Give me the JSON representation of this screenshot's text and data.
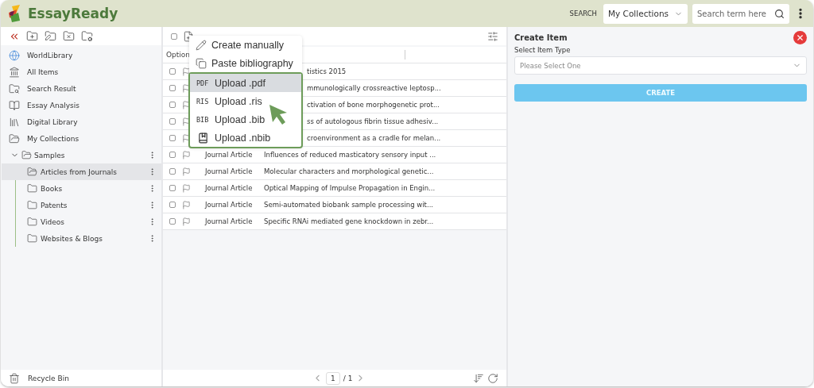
{
  "header": {
    "logo": "EssayReady",
    "search_label": "SEARCH",
    "scope": "My Collections",
    "search": {
      "placeholder": "Search term here"
    }
  },
  "sidebar": {
    "items": [
      {
        "label": "WorldLibrary",
        "selected": false
      },
      {
        "label": "All Items",
        "selected": false
      },
      {
        "label": "Search Result",
        "selected": false
      },
      {
        "label": "Essay Analysis",
        "selected": false
      },
      {
        "label": "Digital Library",
        "selected": false
      },
      {
        "label": "My Collections",
        "selected": false
      }
    ],
    "tree": {
      "label": "Samples",
      "expanded": true,
      "children": [
        {
          "label": "Articles from Journals",
          "selected": true
        },
        {
          "label": "Books",
          "selected": false
        },
        {
          "label": "Patents",
          "selected": false
        },
        {
          "label": "Videos",
          "selected": false
        },
        {
          "label": "Websites & Blogs",
          "selected": false
        }
      ]
    },
    "footer": "Recycle Bin"
  },
  "table": {
    "select_all": {
      "checked": false
    },
    "columns": [
      "Option"
    ],
    "rows": [
      {
        "checked": false,
        "title": "tistics 2015"
      },
      {
        "checked": false,
        "title": "mmunologically crossreactive leptosp..."
      },
      {
        "checked": false,
        "title": "ctivation of bone morphogenetic prot..."
      },
      {
        "checked": false,
        "title": "ss of autologous fibrin tissue adhesiv..."
      },
      {
        "checked": false,
        "title": "croenvironment as a cradle for melan..."
      },
      {
        "checked": false,
        "type": "Journal Article",
        "title": "Influences of reduced masticatory sensory input ..."
      },
      {
        "checked": false,
        "type": "Journal Article",
        "title": "Molecular characters and morphological genetic..."
      },
      {
        "checked": false,
        "type": "Journal Article",
        "title": "Optical Mapping of Impulse Propagation in Engin..."
      },
      {
        "checked": false,
        "type": "Journal Article",
        "title": "Semi-automated biobank sample processing wit..."
      },
      {
        "checked": false,
        "type": "Journal Article",
        "title": "Specific RNAi mediated gene knockdown in zebr..."
      }
    ]
  },
  "menu": {
    "items": [
      {
        "kind": "create",
        "label": "Create manually",
        "selected": false
      },
      {
        "kind": "paste",
        "label": "Paste bibliography",
        "selected": false
      }
    ],
    "upload_items": [
      {
        "kind": "tag",
        "tag": "PDF",
        "label": "Upload .pdf",
        "selected": true
      },
      {
        "kind": "tag",
        "tag": "RIS",
        "label": "Upload .ris",
        "selected": false
      },
      {
        "kind": "tag",
        "tag": "BIB",
        "label": "Upload .bib",
        "selected": false
      },
      {
        "kind": "icon",
        "label": "Upload .nbib",
        "selected": false
      }
    ]
  },
  "pagination": {
    "page": "1",
    "total": "/ 1"
  },
  "panel": {
    "title": "Create Item",
    "field_label": "Select Item Type",
    "placeholder": "Please Select One",
    "button": "CREATE"
  }
}
